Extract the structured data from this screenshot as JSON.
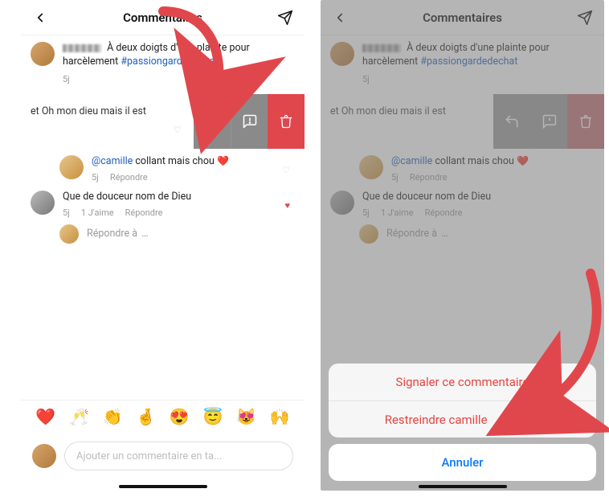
{
  "header": {
    "title": "Commentaires"
  },
  "post": {
    "text_before": "À deux doigts d'une plainte pour harcèlement ",
    "hashtag": "#passiongardedechat",
    "age": "5j"
  },
  "swiped": {
    "visible_text": "et Oh mon dieu mais il est"
  },
  "comment1": {
    "mention": "@camille",
    "text": " collant mais chou ",
    "emoji": "❤️",
    "age": "5j",
    "reply": "Répondre"
  },
  "comment2": {
    "text": "Que de douceur nom de Dieu",
    "age": "5j",
    "likes": "1 J'aime",
    "reply": "Répondre"
  },
  "reply_row": {
    "text": "Répondre à ",
    "dots": "…"
  },
  "emoji_bar": [
    "❤️",
    "🥂",
    "👏",
    "🤞",
    "😍",
    "😇",
    "😻",
    "🙌"
  ],
  "input": {
    "placeholder": "Ajouter un commentaire en ta..."
  },
  "sheet": {
    "report": "Signaler ce commentaire",
    "restrict": "Restreindre camille",
    "cancel": "Annuler"
  }
}
